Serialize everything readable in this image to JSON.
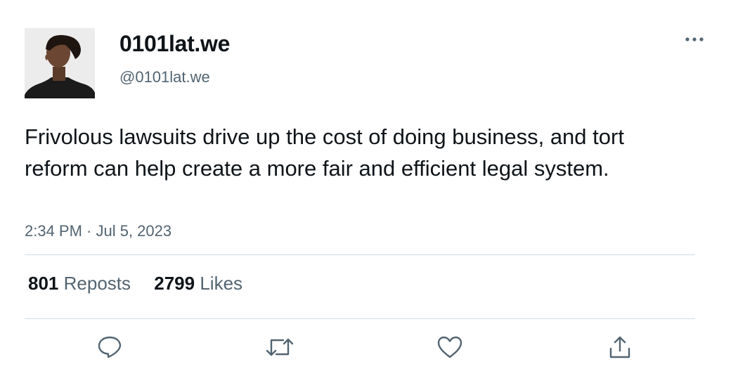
{
  "author": {
    "display_name": "0101lat.we",
    "handle": "@0101lat.we"
  },
  "tweet": {
    "text": "Frivolous lawsuits drive up the cost of doing business, and tort reform can help create a more fair and efficient legal system.",
    "timestamp": "2:34 PM · Jul 5, 2023"
  },
  "stats": {
    "reposts_count": "801",
    "reposts_label": "Reposts",
    "likes_count": "2799",
    "likes_label": "Likes"
  },
  "icons": {
    "more": "more-horizontal-icon",
    "reply": "reply-icon",
    "repost": "repost-icon",
    "like": "heart-icon",
    "share": "share-icon"
  },
  "colors": {
    "text_primary": "#0f1419",
    "text_secondary": "#536471",
    "divider": "#cfd9de"
  }
}
